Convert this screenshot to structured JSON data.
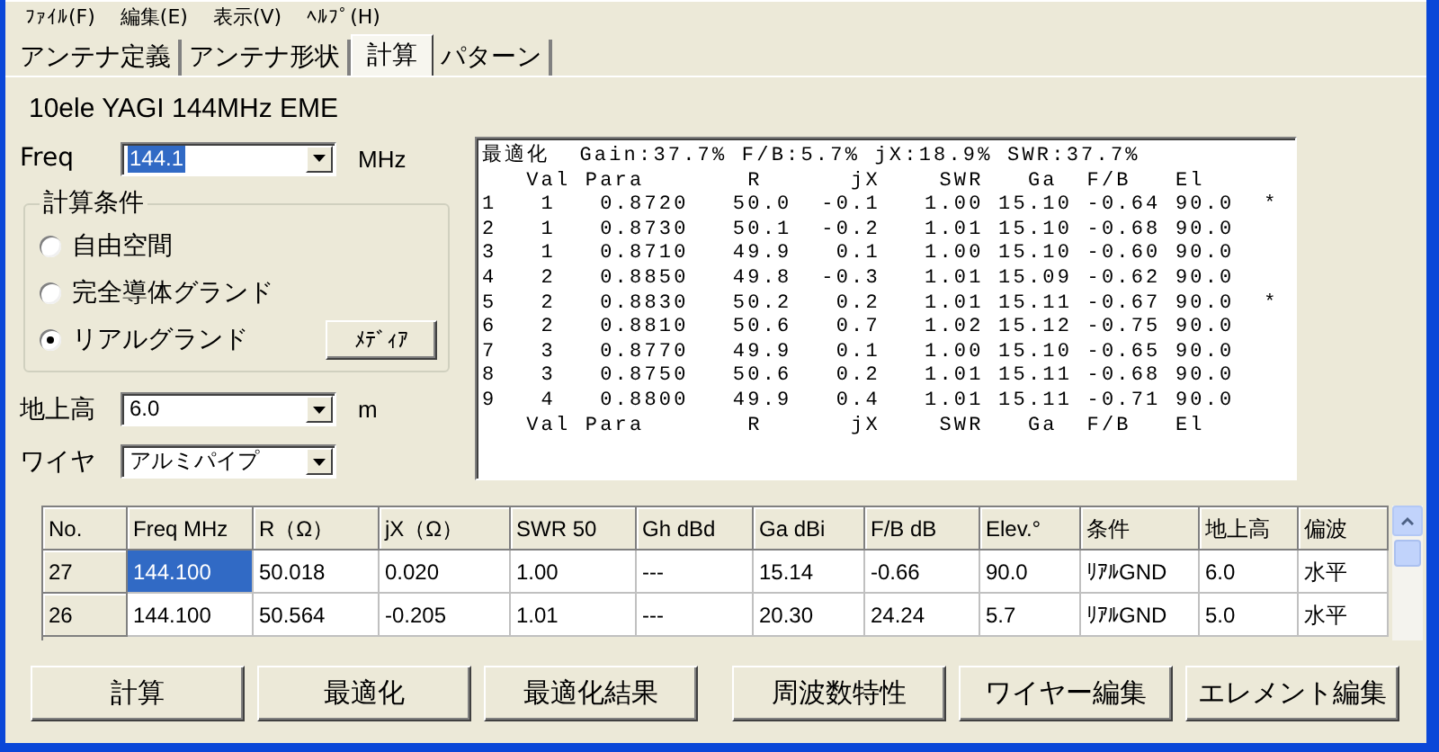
{
  "menu": [
    "ﾌｧｲﾙ(F)",
    "編集(E)",
    "表示(V)",
    "ﾍﾙﾌﾟ(H)"
  ],
  "tabs": [
    {
      "label": "アンテナ定義",
      "selected": false
    },
    {
      "label": "アンテナ形状",
      "selected": false
    },
    {
      "label": "計算",
      "selected": true
    },
    {
      "label": "パターン",
      "selected": false
    }
  ],
  "antenna_name": "10ele YAGI 144MHz EME",
  "freq": {
    "label": "Freq",
    "value": "144.1",
    "text_selected": true,
    "unit": "MHz"
  },
  "conditions": {
    "title": "計算条件",
    "media_button": "ﾒﾃﾞｨｱ",
    "options": [
      {
        "label": "自由空間",
        "selected": false
      },
      {
        "label": "完全導体グランド",
        "selected": false
      },
      {
        "label": "リアルグランド",
        "selected": true
      }
    ]
  },
  "height": {
    "label": "地上高",
    "value": "6.0",
    "unit": "m"
  },
  "wire": {
    "label": "ワイヤ",
    "value": "アルミパイプ"
  },
  "results": {
    "lines": [
      "最適化  Gain:37.7% F/B:5.7% jX:18.9% SWR:37.7%",
      "   Val Para       R      jX    SWR   Ga  F/B   El",
      "1   1   0.8720   50.0  -0.1   1.00 15.10 -0.64 90.0  *",
      "2   1   0.8730   50.1  -0.2   1.01 15.10 -0.68 90.0",
      "3   1   0.8710   49.9   0.1   1.00 15.10 -0.60 90.0",
      "4   2   0.8850   49.8  -0.3   1.01 15.09 -0.62 90.0",
      "5   2   0.8830   50.2   0.2   1.01 15.11 -0.67 90.0  *",
      "6   2   0.8810   50.6   0.7   1.02 15.12 -0.75 90.0",
      "7   3   0.8770   49.9   0.1   1.00 15.10 -0.65 90.0",
      "8   3   0.8750   50.6   0.2   1.01 15.11 -0.68 90.0",
      "9   4   0.8800   49.9   0.4   1.01 15.11 -0.71 90.0",
      "   Val Para       R      jX    SWR   Ga  F/B   El"
    ]
  },
  "table": {
    "columns": [
      "No.",
      "Freq MHz",
      "R（Ω）",
      "jX（Ω）",
      "SWR 50",
      "Gh dBd",
      "Ga dBi",
      "F/B dB",
      "Elev.°",
      "条件",
      "地上高",
      "偏波"
    ],
    "rows": [
      {
        "selected": true,
        "cells": [
          "27",
          "144.100",
          "50.018",
          "0.020",
          "1.00",
          "---",
          "15.14",
          "-0.66",
          "90.0",
          "ﾘｱﾙGND",
          "6.0",
          "水平"
        ]
      },
      {
        "selected": false,
        "cells": [
          "26",
          "144.100",
          "50.564",
          "-0.205",
          "1.01",
          "---",
          "20.30",
          "24.24",
          "5.7",
          "ﾘｱﾙGND",
          "5.0",
          "水平"
        ]
      }
    ]
  },
  "buttons": [
    "計算",
    "最適化",
    "最適化結果",
    "周波数特性",
    "ワイヤー編集",
    "エレメント編集"
  ]
}
